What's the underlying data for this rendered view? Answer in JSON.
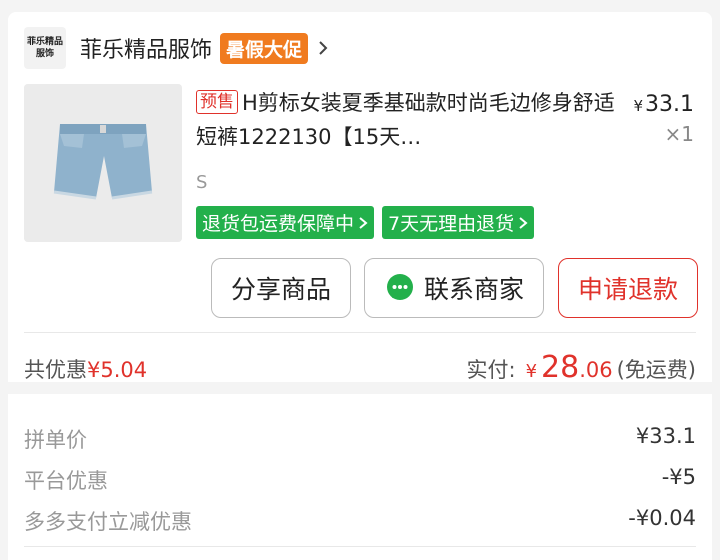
{
  "shop": {
    "logo_line1": "菲乐精品",
    "logo_line2": "服饰",
    "name": "菲乐精品服饰",
    "badge": "暑假大促"
  },
  "product": {
    "presale_tag": "预售",
    "title": "H剪标女装夏季基础款时尚毛边修身舒适短裤1222130【15天…",
    "currency": "¥",
    "price": "33.1",
    "quantity": "×1",
    "spec": "S"
  },
  "tags": [
    {
      "label": "退货包运费保障中"
    },
    {
      "label": "7天无理由退货"
    }
  ],
  "buttons": {
    "share": "分享商品",
    "contact": "联系商家",
    "refund": "申请退款"
  },
  "summary": {
    "discount_label": "共优惠",
    "discount_value": "¥5.04",
    "paid_label": "实付:",
    "paid_currency": "¥",
    "paid_int": "28",
    "paid_dec": ".06",
    "shipping_note": "(免运费)"
  },
  "details": [
    {
      "label": "拼单价",
      "value": "¥33.1"
    },
    {
      "label": "平台优惠",
      "value": "-¥5"
    },
    {
      "label": "多多支付立减优惠",
      "value": "-¥0.04"
    }
  ],
  "colors": {
    "accent_red": "#e0322b",
    "badge_orange": "#f07b1f",
    "tag_green": "#23b04b"
  }
}
